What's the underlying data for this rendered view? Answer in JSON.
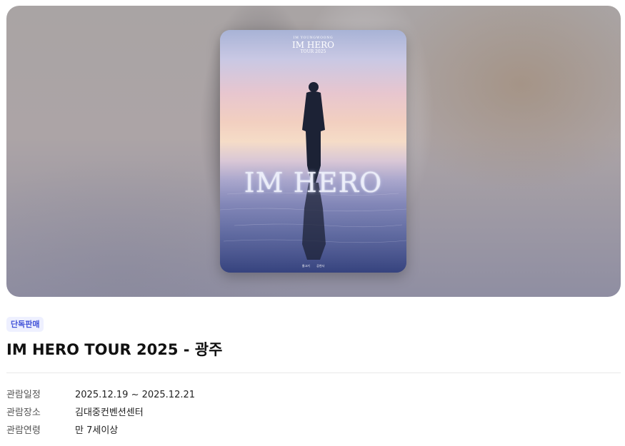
{
  "poster": {
    "brand": "IM YOUNGWOONG",
    "title": "IM HERO",
    "subtitle": "TOUR 2025",
    "big_title": "IM HERO",
    "logos": [
      "물고기",
      "공연사"
    ]
  },
  "product": {
    "badge": "단독판매",
    "title": "IM HERO TOUR 2025 - 광주"
  },
  "info": [
    {
      "label": "관람일정",
      "value": "2025.12.19 ~ 2025.12.21"
    },
    {
      "label": "관람장소",
      "value": "김대중컨벤션센터"
    },
    {
      "label": "관람연령",
      "value": "만 7세이상"
    }
  ],
  "colors": {
    "badge_bg": "#eef0ff",
    "badge_text": "#4253d8",
    "divider": "#e8e8e8"
  }
}
